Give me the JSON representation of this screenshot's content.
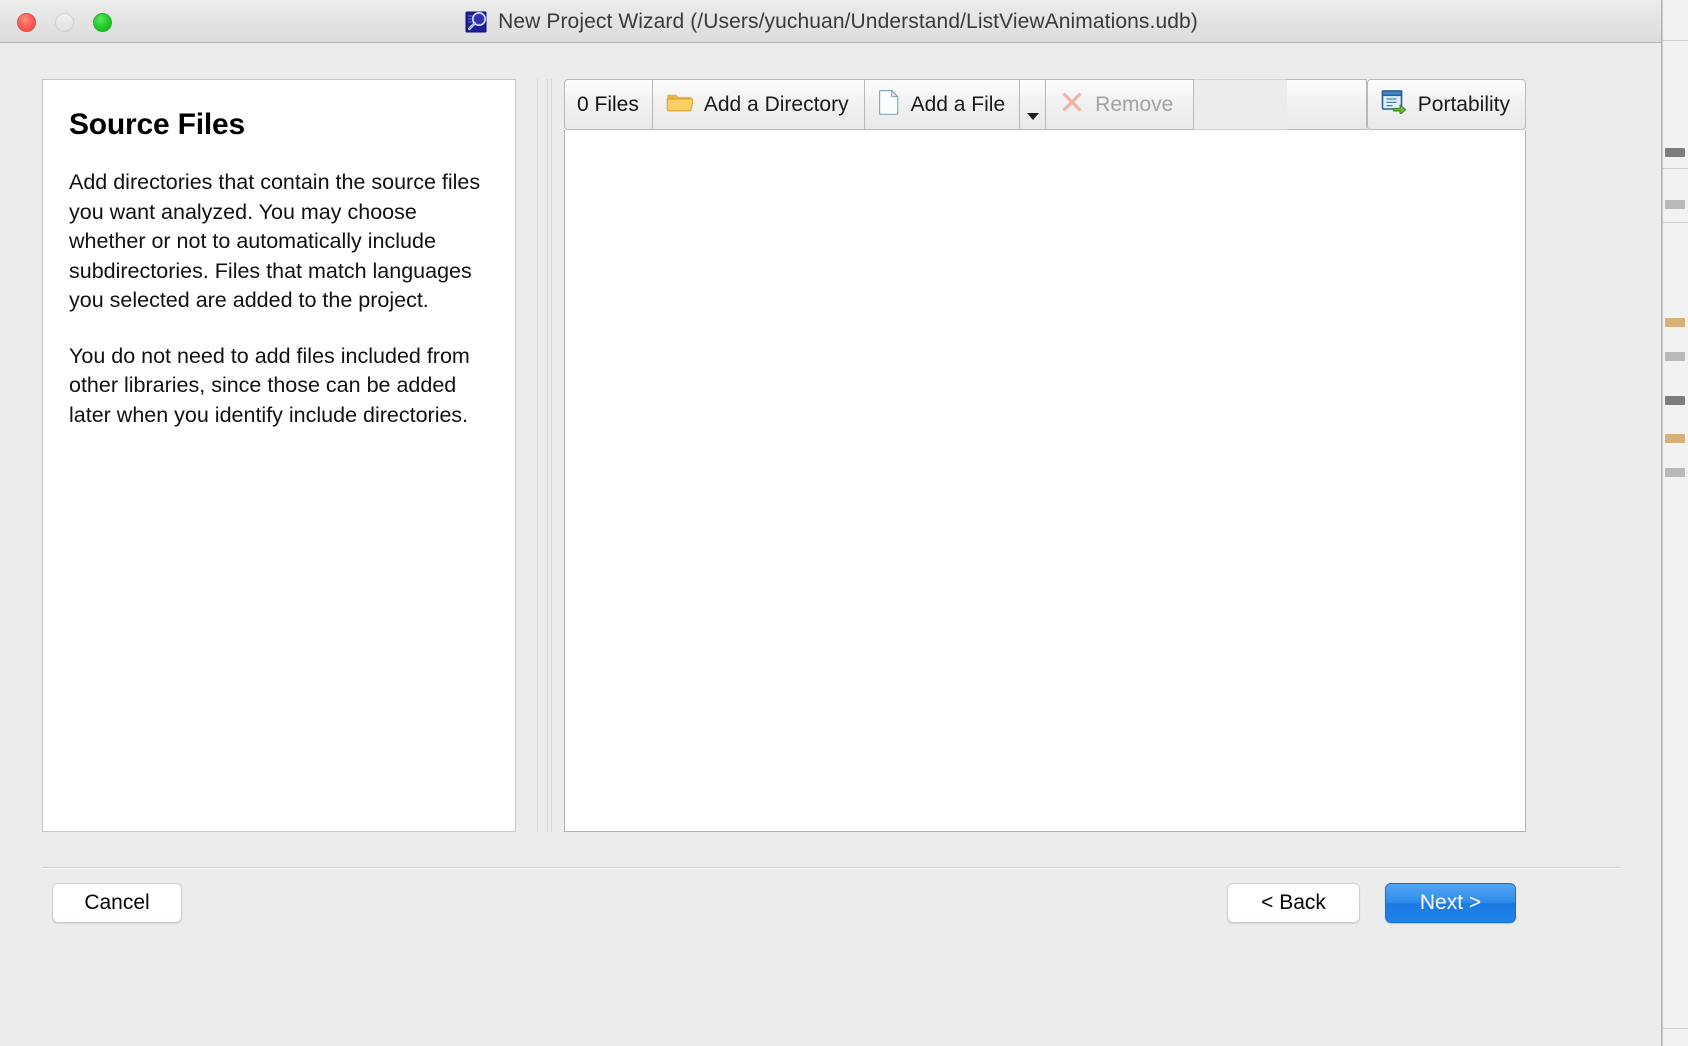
{
  "window": {
    "title": "New Project Wizard (/Users/yuchuan/Understand/ListViewAnimations.udb)",
    "app_icon": "understand-magnifier-icon",
    "traffic_lights": {
      "close": "close-window-button",
      "minimize": "minimize-window-button",
      "zoom": "zoom-window-button"
    }
  },
  "description_panel": {
    "title": "Source Files",
    "paragraphs": [
      "Add directories that contain the source files you want analyzed. You may choose whether or not to automatically include subdirectories. Files that match languages you selected are added to the project.",
      "You do not need to add files included from other libraries, since those can be added later when you identify include directories."
    ]
  },
  "files_panel": {
    "toolbar": {
      "count_label": "0 Files",
      "add_directory_label": "Add a Directory",
      "add_directory_icon": "folder-icon",
      "add_file_label": "Add a File",
      "add_file_icon": "document-icon",
      "add_file_menu_icon": "chevron-down-icon",
      "remove_label": "Remove",
      "remove_icon": "x-mark-icon",
      "remove_enabled": false,
      "portability_label": "Portability",
      "portability_icon": "window-export-icon"
    },
    "list_items": []
  },
  "footer": {
    "cancel_label": "Cancel",
    "back_label": "< Back",
    "next_label": "Next >"
  },
  "colors": {
    "accent_blue": "#2f8cec",
    "window_chrome": "#ececec",
    "panel_white": "#ffffff",
    "disabled_text": "#a2a2a2",
    "traffic_close": "#fb6159",
    "traffic_zoom": "#25ce2c"
  }
}
